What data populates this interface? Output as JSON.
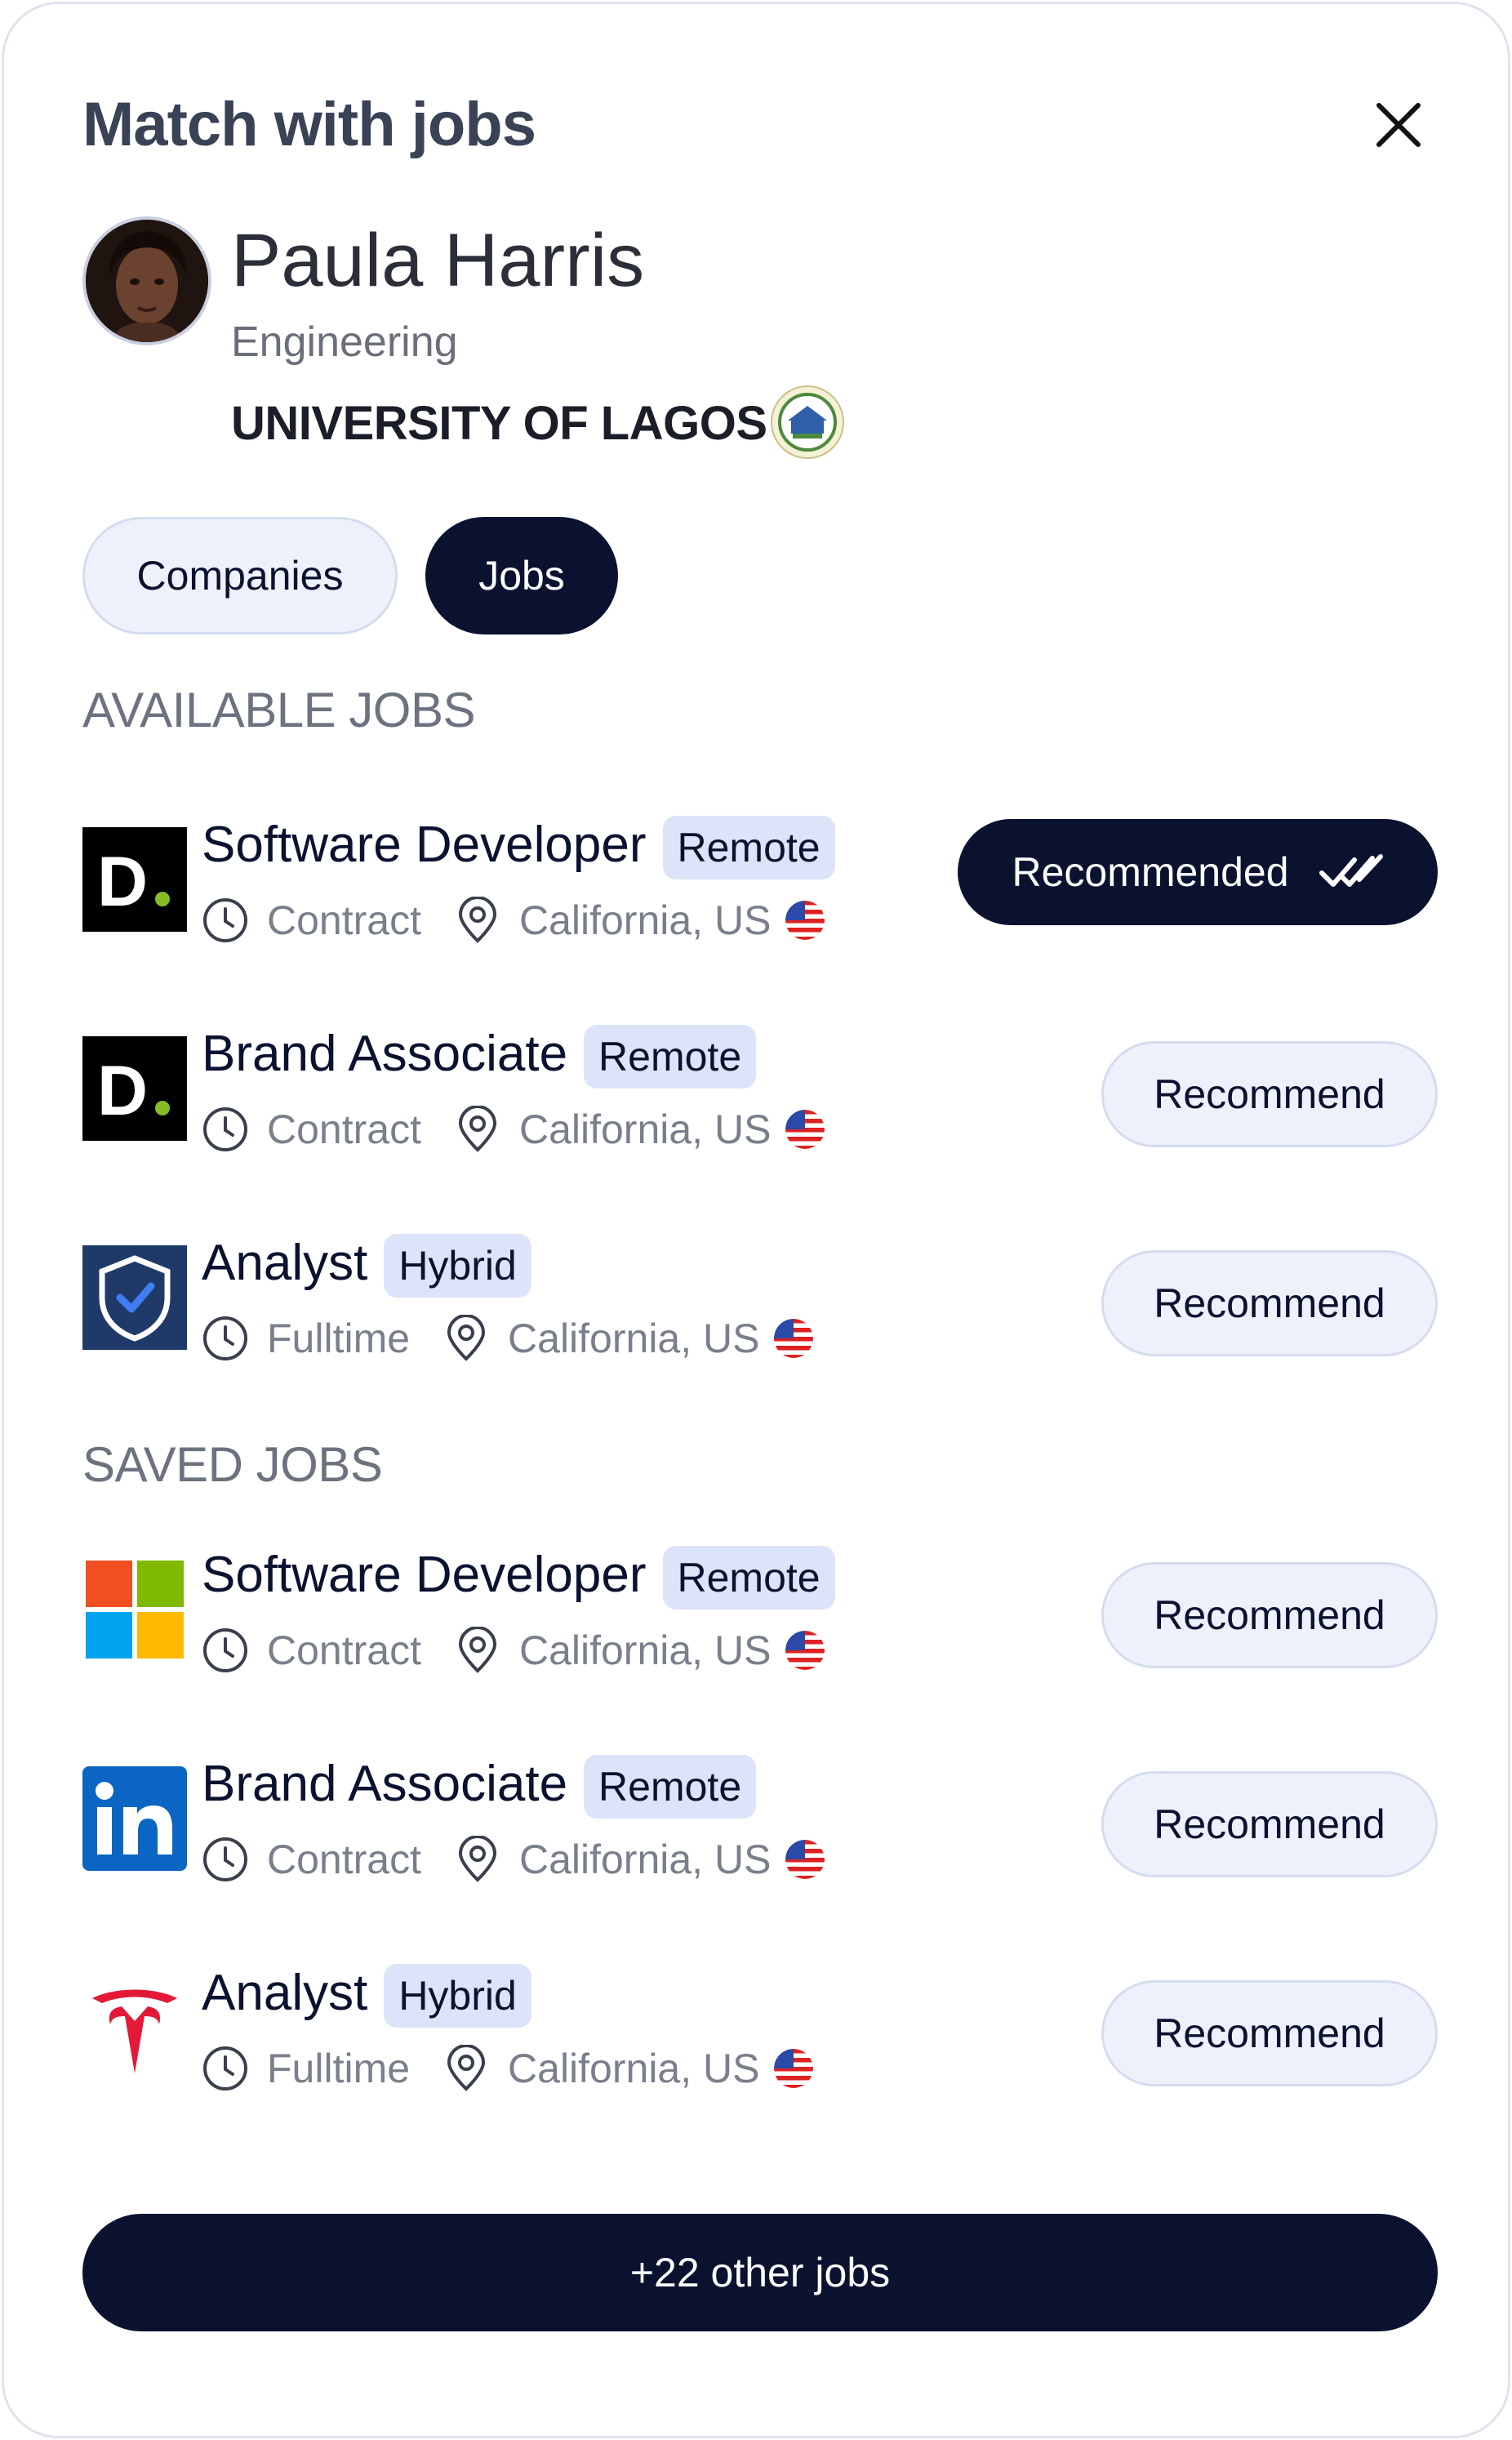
{
  "header": {
    "title": "Match with jobs",
    "close_icon": "close-icon"
  },
  "profile": {
    "name": "Paula Harris",
    "department": "Engineering",
    "university": "UNIVERSITY OF LAGOS"
  },
  "tabs": {
    "companies": "Companies",
    "jobs": "Jobs",
    "active": "Jobs"
  },
  "sections": {
    "available_title": "AVAILABLE JOBS",
    "saved_title": "SAVED JOBS"
  },
  "available_jobs": [
    {
      "company_logo": "deloitte-logo",
      "title": "Software Developer",
      "tag": "Remote",
      "type": "Contract",
      "location": "California, US",
      "action": "Recommended",
      "recommended": true
    },
    {
      "company_logo": "deloitte-logo",
      "title": "Brand Associate",
      "tag": "Remote",
      "type": "Contract",
      "location": "California, US",
      "action": "Recommend",
      "recommended": false
    },
    {
      "company_logo": "shield-check-logo",
      "title": "Analyst",
      "tag": "Hybrid",
      "type": "Fulltime",
      "location": "California, US",
      "action": "Recommend",
      "recommended": false
    }
  ],
  "saved_jobs": [
    {
      "company_logo": "microsoft-logo",
      "title": "Software Developer",
      "tag": "Remote",
      "type": "Contract",
      "location": "California, US",
      "action": "Recommend",
      "recommended": false
    },
    {
      "company_logo": "linkedin-logo",
      "title": "Brand Associate",
      "tag": "Remote",
      "type": "Contract",
      "location": "California, US",
      "action": "Recommend",
      "recommended": false
    },
    {
      "company_logo": "tesla-logo",
      "title": "Analyst",
      "tag": "Hybrid",
      "type": "Fulltime",
      "location": "California, US",
      "action": "Recommend",
      "recommended": false
    }
  ],
  "footer": {
    "more_label": "+22 other jobs"
  },
  "colors": {
    "primary": "#0b1230",
    "pill_bg": "#eef1fc",
    "tag_bg": "#dde3f8",
    "muted": "#7a7f8c"
  }
}
